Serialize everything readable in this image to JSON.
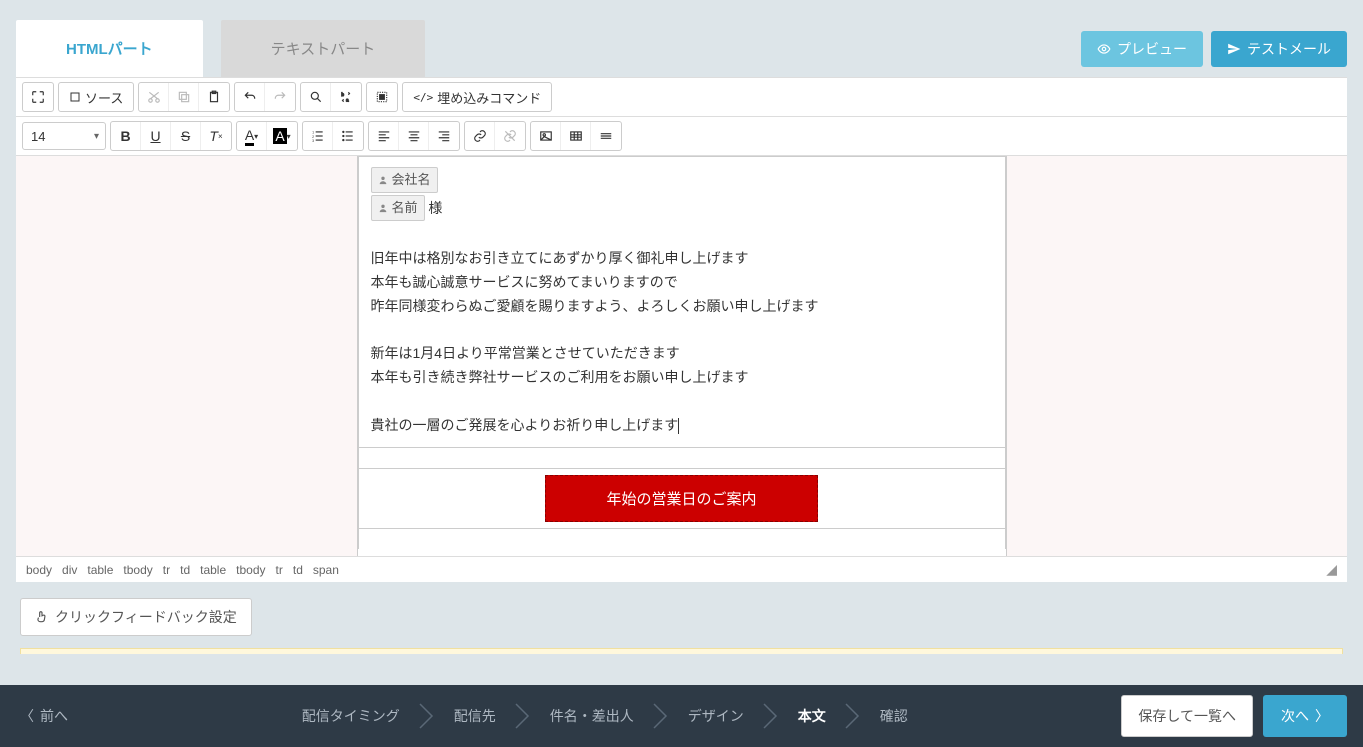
{
  "tabs": {
    "html": "HTMLパート",
    "text": "テキストパート"
  },
  "top_buttons": {
    "preview": "プレビュー",
    "test_mail": "テストメール"
  },
  "toolbar": {
    "source": "ソース",
    "embed": "埋め込みコマンド",
    "font_size": "14"
  },
  "editor": {
    "merge_company": "会社名",
    "merge_name": "名前",
    "merge_suffix": "様",
    "line1": "旧年中は格別なお引き立てにあずかり厚く御礼申し上げます",
    "line2": "本年も誠心誠意サービスに努めてまいりますので",
    "line3": "昨年同様変わらぬご愛顧を賜りますよう、よろしくお願い申し上げます",
    "line4": "新年は1月4日より平常営業とさせていただきます",
    "line5": "本年も引き続き弊社サービスのご利用をお願い申し上げます",
    "line6": "貴社の一層のご発展を心よりお祈り申し上げます",
    "red_button": "年始の営業日のご案内"
  },
  "breadcrumb": [
    "body",
    "div",
    "table",
    "tbody",
    "tr",
    "td",
    "table",
    "tbody",
    "tr",
    "td",
    "span"
  ],
  "click_feedback": "クリックフィードバック設定",
  "bottom": {
    "prev": "前へ",
    "steps": [
      "配信タイミング",
      "配信先",
      "件名・差出人",
      "デザイン",
      "本文",
      "確認"
    ],
    "active_step": 4,
    "save": "保存して一覧へ",
    "next": "次へ"
  }
}
